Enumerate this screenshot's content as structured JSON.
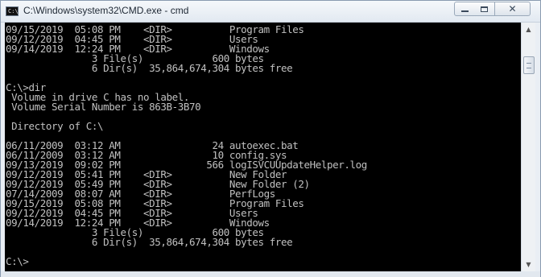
{
  "window": {
    "title": "C:\\Windows\\system32\\CMD.exe - cmd",
    "icon_glyph": "C:\\",
    "icon": "cmd-app-icon",
    "buttons": {
      "minimize": "minimize-icon",
      "maximize": "maximize-icon",
      "close": "close-icon",
      "close_glyph": "✕"
    }
  },
  "console": {
    "lines": [
      "09/15/2019  05:08 PM    <DIR>          Program Files",
      "09/12/2019  04:45 PM    <DIR>          Users",
      "09/14/2019  12:24 PM    <DIR>          Windows",
      "               3 File(s)            600 bytes",
      "               6 Dir(s)  35,864,674,304 bytes free",
      "",
      "C:\\>dir",
      " Volume in drive C has no label.",
      " Volume Serial Number is 863B-3B70",
      "",
      " Directory of C:\\",
      "",
      "06/11/2009  03:12 AM                24 autoexec.bat",
      "06/11/2009  03:12 AM                10 config.sys",
      "09/13/2019  09:02 PM               566 logISVCUUpdateHelper.log",
      "09/12/2019  05:41 PM    <DIR>          New Folder",
      "09/12/2019  05:49 PM    <DIR>          New Folder (2)",
      "07/14/2009  08:07 AM    <DIR>          PerfLogs",
      "09/15/2019  05:08 PM    <DIR>          Program Files",
      "09/12/2019  04:45 PM    <DIR>          Users",
      "09/14/2019  12:24 PM    <DIR>          Windows",
      "               3 File(s)            600 bytes",
      "               6 Dir(s)  35,864,674,304 bytes free",
      "",
      "C:\\>"
    ],
    "colors": {
      "background": "#000000",
      "foreground": "#c0c0c0"
    }
  },
  "scrollbar": {
    "up_icon": "scroll-up-arrow-icon",
    "down_icon": "scroll-down-arrow-icon",
    "up_glyph": "▲",
    "down_glyph": "▼"
  }
}
